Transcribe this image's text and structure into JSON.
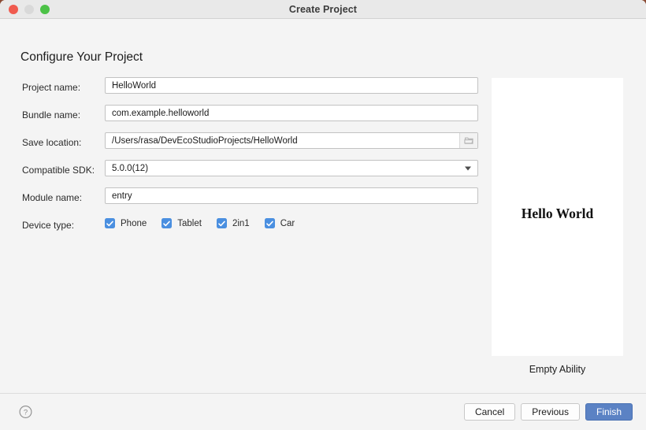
{
  "window": {
    "title": "Create Project",
    "traffic_lights": [
      {
        "name": "close-button",
        "color": "#f05b4f"
      },
      {
        "name": "minimize-button",
        "color": "#d9d9d9"
      },
      {
        "name": "zoom-button",
        "color": "#4cc247"
      }
    ]
  },
  "heading": "Configure Your Project",
  "form": {
    "fields": [
      {
        "id": "project-name",
        "label": "Project name:",
        "value": "HelloWorld",
        "placeholder": "Project name",
        "type": "text"
      },
      {
        "id": "bundle-name",
        "label": "Bundle name:",
        "value": "com.example.helloworld",
        "placeholder": "Bundle name",
        "type": "text"
      },
      {
        "id": "save-location",
        "label": "Save location:",
        "value": "/Users/rasa/DevEcoStudioProjects/HelloWorld",
        "placeholder": "Save location",
        "type": "text-with-browse",
        "browse_icon": "folder-icon"
      },
      {
        "id": "compatible-sdk",
        "label": "Compatible SDK:",
        "value": "5.0.0(12)",
        "placeholder": "Select SDK",
        "type": "select",
        "dropdown_icon": "chevron-down-icon"
      },
      {
        "id": "module-name",
        "label": "Module name:",
        "value": "entry",
        "placeholder": "Module name",
        "type": "text"
      }
    ],
    "device_type": {
      "label": "Device type:",
      "options": [
        {
          "label": "Phone",
          "checked": true
        },
        {
          "label": "Tablet",
          "checked": true
        },
        {
          "label": "2in1",
          "checked": true
        },
        {
          "label": "Car",
          "checked": true
        }
      ]
    }
  },
  "preview": {
    "screen_text": "Hello World",
    "caption": "Empty Ability"
  },
  "footer": {
    "help_icon": "help-circle-icon",
    "buttons": [
      {
        "label": "Cancel",
        "style": "secondary"
      },
      {
        "label": "Previous",
        "style": "secondary"
      },
      {
        "label": "Finish",
        "style": "primary"
      }
    ]
  },
  "colors": {
    "accent": "#5b82c4",
    "checkbox": "#4a8fe0",
    "window_bg": "#f4f4f4",
    "titlebar_bg": "#e9e9e9",
    "field_bg": "#ffffff",
    "border": "#c2c2c2"
  }
}
